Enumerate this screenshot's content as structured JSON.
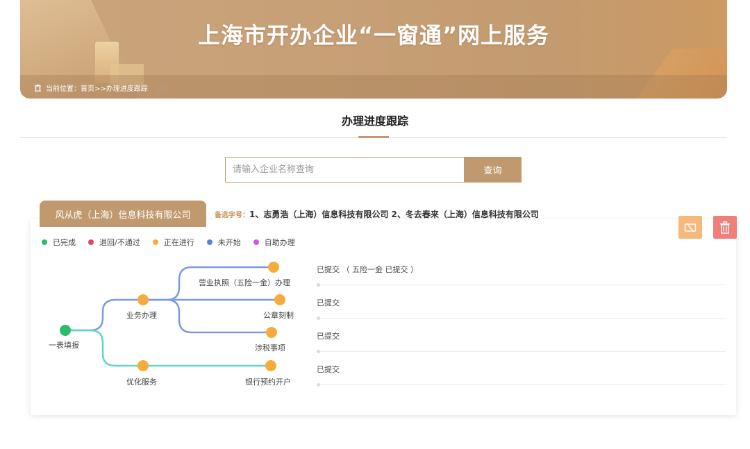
{
  "banner": {
    "title": "上海市开办企业“一窗通”网上服务",
    "breadcrumb_prefix": "当前位置：",
    "breadcrumb_home": "首页",
    "breadcrumb_sep": ">>",
    "breadcrumb_current": "办理进度跟踪"
  },
  "page": {
    "title": "办理进度跟踪"
  },
  "search": {
    "placeholder": "请输入企业名称查询",
    "value": "",
    "button_label": "查询"
  },
  "company": {
    "name": "风从虎（上海）信息科技有限公司",
    "alt_label": "备选字号：",
    "alt_names": "1、志勇浩（上海）信息科技有限公司 2、冬去春来（上海）信息科技有限公司"
  },
  "legend": [
    {
      "label": "已完成",
      "color": "#2dbb6a"
    },
    {
      "label": "退回/不通过",
      "color": "#e8436a"
    },
    {
      "label": "正在进行",
      "color": "#f5ac3c"
    },
    {
      "label": "未开始",
      "color": "#5b7fe3"
    },
    {
      "label": "自助办理",
      "color": "#cf56e8"
    }
  ],
  "tree": {
    "root": "一表填报",
    "branch1": "业务办理",
    "branch2": "优化服务",
    "leaves": [
      "营业执照（五险一金）办理",
      "公章刻制",
      "涉税事项",
      "银行预约开户"
    ],
    "colors": {
      "done": "#2dbb6a",
      "progress": "#f5ac3c",
      "line_blue": "#7a9be3",
      "line_teal": "#5fd6c2"
    }
  },
  "statuses": [
    "已提交 （ 五险一金 已提交 ）",
    "已提交",
    "已提交",
    "已提交"
  ],
  "actions": {
    "unbind_icon": "unbind-icon",
    "delete_icon": "trash-icon"
  }
}
